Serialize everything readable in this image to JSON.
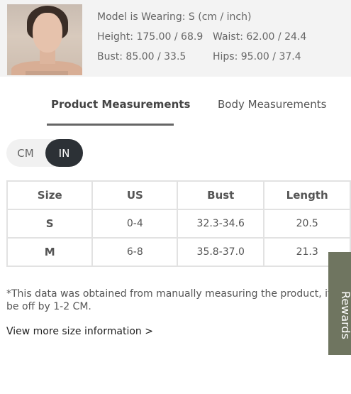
{
  "model": {
    "wearing": "Model is Wearing: S (cm / inch)",
    "height": "Height: 175.00 / 68.9",
    "waist": "Waist: 62.00 / 24.4",
    "bust": "Bust: 85.00 / 33.5",
    "hips": "Hips: 95.00 / 37.4"
  },
  "tabs": {
    "product": "Product Measurements",
    "body": "Body Measurements",
    "active": "product"
  },
  "units": {
    "cm": "CM",
    "in": "IN",
    "selected": "IN"
  },
  "table": {
    "headers": [
      "Size",
      "US",
      "Bust",
      "Length"
    ],
    "rows": [
      [
        "S",
        "0-4",
        "32.3-34.6",
        "20.5"
      ],
      [
        "M",
        "6-8",
        "35.8-37.0",
        "21.3"
      ]
    ]
  },
  "note": "*This data was obtained from manually measuring the product, it may be off by 1-2 CM.",
  "more_link": "View more size information >",
  "side_tab": "Rewards",
  "colors": {
    "accent_dark": "#2c3136",
    "side_tab": "#6f7560",
    "card_bg": "#f3f3f3"
  }
}
